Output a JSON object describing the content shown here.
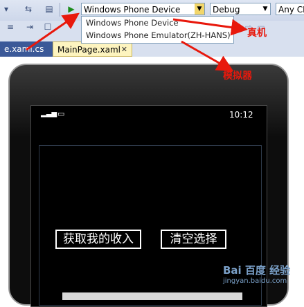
{
  "toolbar": {
    "device_combo": "Windows Phone Device",
    "config_combo": "Debug",
    "platform_combo": "Any CP"
  },
  "dropdown": {
    "items": [
      "Windows Phone Device",
      "Windows Phone Emulator(ZH-HANS)"
    ]
  },
  "tabs": [
    {
      "label": "e.xaml.cs"
    },
    {
      "label": "MainPage.xaml"
    }
  ],
  "phone": {
    "time": "10:12",
    "button_income": "获取我的收入",
    "button_clear": "清空选择"
  },
  "annotations": {
    "real_device": "真机",
    "emulator": "模拟器"
  },
  "watermark": {
    "logo": "Bai 百度 经验",
    "url": "jingyan.baidu.com"
  },
  "colors": {
    "annotation_red": "#e8180c",
    "tab_active": "#fdf4bf",
    "phone_text": "#ffffff"
  }
}
